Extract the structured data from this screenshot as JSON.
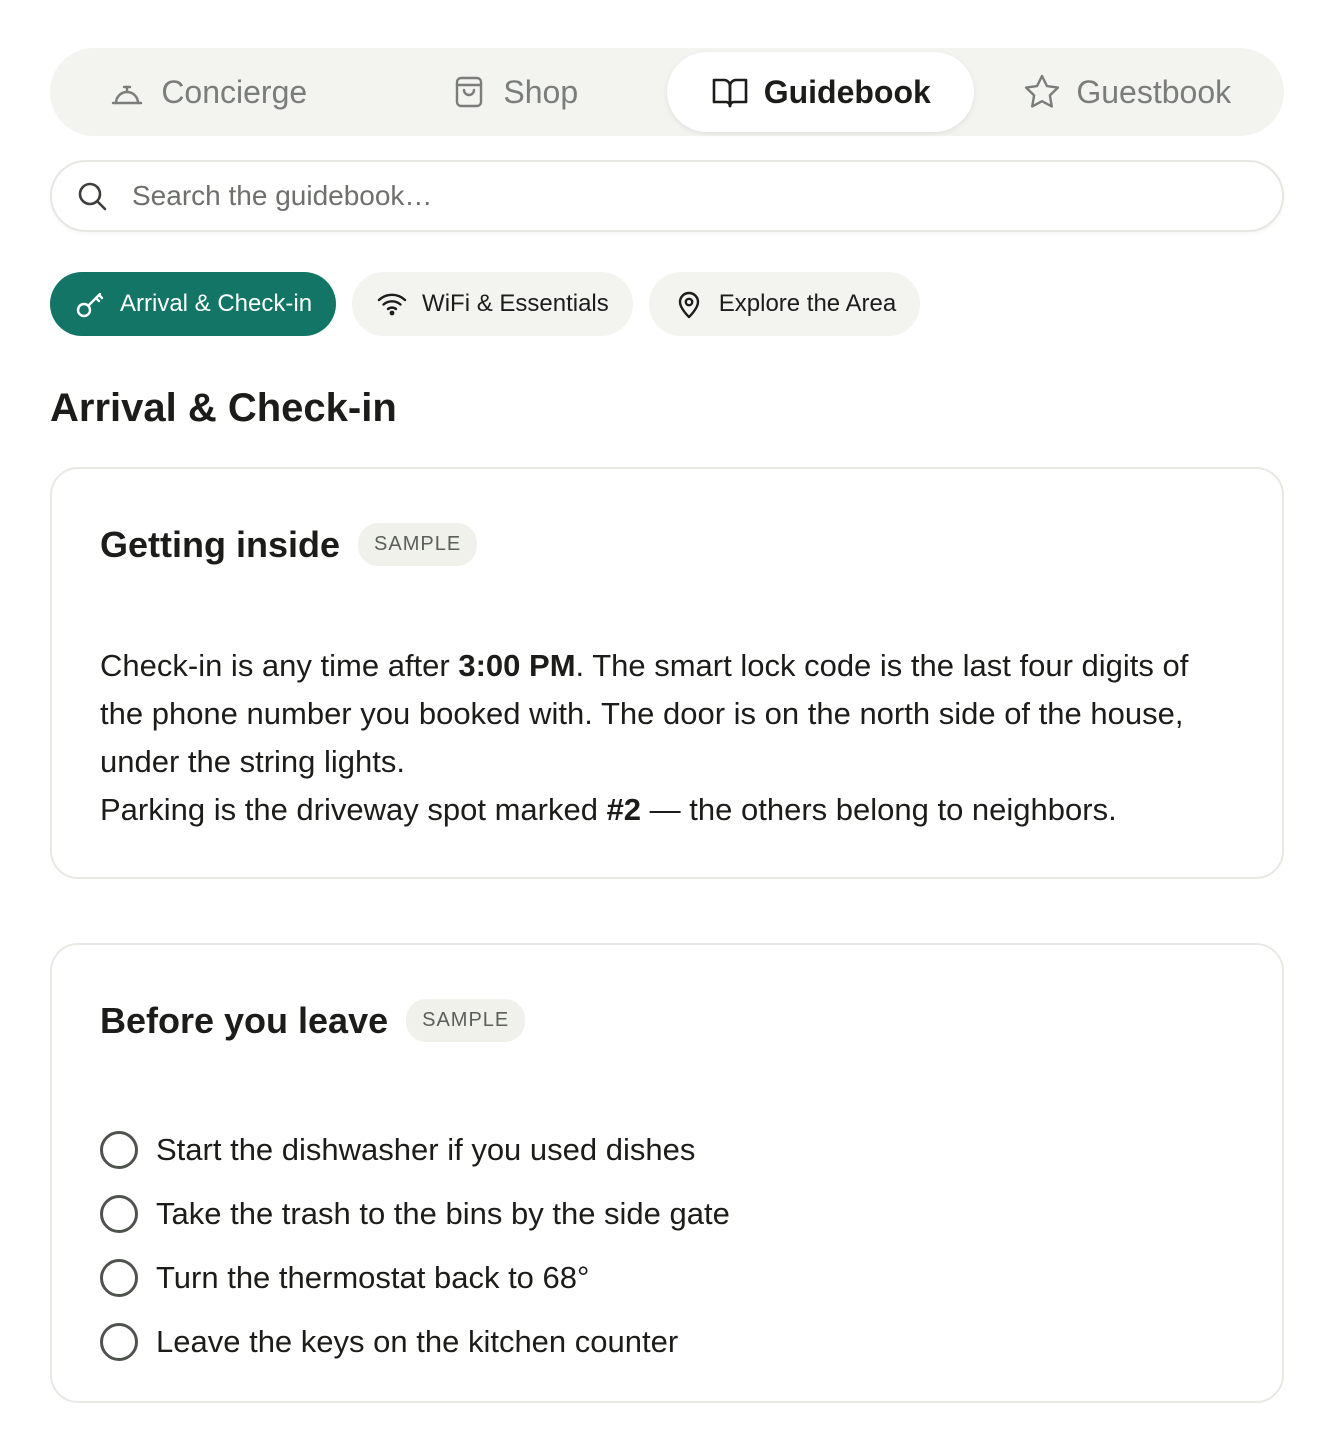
{
  "tabs": [
    {
      "label": "Concierge",
      "icon": "bell-icon"
    },
    {
      "label": "Shop",
      "icon": "shopping-bag-icon"
    },
    {
      "label": "Guidebook",
      "icon": "book-icon",
      "active": true
    },
    {
      "label": "Guestbook",
      "icon": "star-icon"
    }
  ],
  "search": {
    "placeholder": "Search the guidebook…",
    "value": ""
  },
  "categories": [
    {
      "label": "Arrival & Check-in",
      "icon": "key-icon",
      "active": true
    },
    {
      "label": "WiFi & Essentials",
      "icon": "wifi-icon"
    },
    {
      "label": "Explore the Area",
      "icon": "map-pin-icon"
    }
  ],
  "section_title": "Arrival & Check-in",
  "cards": [
    {
      "title": "Getting inside",
      "badge": "SAMPLE",
      "body": {
        "p1_a": "Check-in is any time after ",
        "p1_b": "3:00 PM",
        "p1_c": ". The smart lock code is the last four digits of the phone number you booked with. The door is on the north side of the house, under the string lights.",
        "p2_a": "Parking is the driveway spot marked ",
        "p2_b": "#2",
        "p2_c": " — the others belong to neighbors."
      }
    },
    {
      "title": "Before you leave",
      "badge": "SAMPLE",
      "checklist": [
        {
          "label": "Start the dishwasher if you used dishes",
          "checked": false
        },
        {
          "label": "Take the trash to the bins by the side gate",
          "checked": false
        },
        {
          "label": "Turn the thermostat back to 68°",
          "checked": false
        },
        {
          "label": "Leave the keys on the kitchen counter",
          "checked": false
        }
      ]
    }
  ],
  "colors": {
    "accent": "#137566",
    "tab_bar_bg": "#f3f3ef",
    "text": "#1c1c1a",
    "muted": "#7a7d79"
  }
}
